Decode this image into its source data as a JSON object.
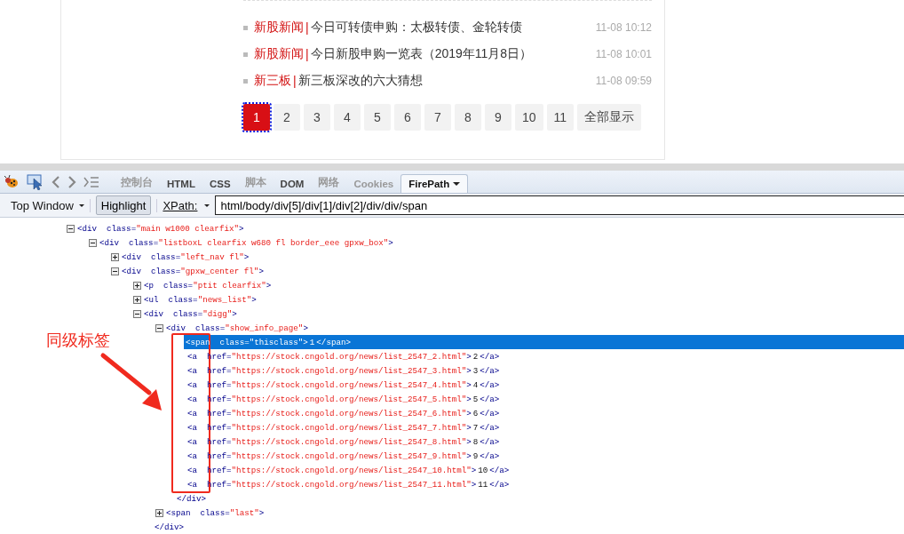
{
  "news": [
    {
      "category": "新股新闻",
      "separator": "|",
      "title": "今日可转债申购：太极转债、金轮转债",
      "time": "11-08 10:12"
    },
    {
      "category": "新股新闻",
      "separator": "|",
      "title": "今日新股申购一览表（2019年11月8日）",
      "time": "11-08 10:01"
    },
    {
      "category": "新三板",
      "separator": "|",
      "title": "新三板深改的六大猜想",
      "time": "11-08 09:59"
    }
  ],
  "pagination": [
    {
      "label": "1",
      "selected": true
    },
    {
      "label": "2",
      "selected": false
    },
    {
      "label": "3",
      "selected": false
    },
    {
      "label": "4",
      "selected": false
    },
    {
      "label": "5",
      "selected": false
    },
    {
      "label": "6",
      "selected": false
    },
    {
      "label": "7",
      "selected": false
    },
    {
      "label": "8",
      "selected": false
    },
    {
      "label": "9",
      "selected": false
    },
    {
      "label": "10",
      "selected": false
    },
    {
      "label": "11",
      "selected": false
    },
    {
      "label": "全部显示",
      "selected": false
    }
  ],
  "devtools": {
    "tabs": [
      {
        "label": "控制台",
        "selected": false,
        "disabled": true
      },
      {
        "label": "HTML",
        "selected": false,
        "disabled": false
      },
      {
        "label": "CSS",
        "selected": false,
        "disabled": false
      },
      {
        "label": "脚本",
        "selected": false,
        "disabled": true
      },
      {
        "label": "DOM",
        "selected": false,
        "disabled": false
      },
      {
        "label": "网络",
        "selected": false,
        "disabled": true
      },
      {
        "label": "Cookies",
        "selected": false,
        "disabled": true
      },
      {
        "label": "FirePath",
        "selected": true,
        "disabled": false,
        "dropdown": true
      }
    ],
    "window_select": "Top Window",
    "highlight": {
      "label": "Highlight",
      "on": true
    },
    "xpath_label": "XPath:",
    "xpath_value": "html/body/div[5]/div[1]/div[2]/div/div/span",
    "tree": [
      {
        "open": "<div",
        "attr": "class=",
        "value": "\"main w1000 clearfix\"",
        "end": ">",
        "expanded": true,
        "selected": false,
        "children": [
          {
            "open": "<div",
            "attr": "class=",
            "value": "\"listboxL clearfix w680 fl border_eee gpxw_box\"",
            "end": ">",
            "expanded": true,
            "selected": false,
            "children": [
              {
                "open": "<div",
                "attr": "class=",
                "value": "\"left_nav fl\"",
                "end": ">",
                "expanded": false,
                "selected": false
              },
              {
                "open": "<div",
                "attr": "class=",
                "value": "\"gpxw_center fl\"",
                "end": ">",
                "expanded": true,
                "selected": false,
                "children": [
                  {
                    "open": "<p",
                    "attr": "class=",
                    "value": "\"ptit clearfix\"",
                    "end": ">",
                    "expanded": false,
                    "selected": false
                  },
                  {
                    "open": "<ul",
                    "attr": "class=",
                    "value": "\"news_list\"",
                    "end": ">",
                    "expanded": false,
                    "selected": false
                  },
                  {
                    "open": "<div",
                    "attr": "class=",
                    "value": "\"digg\"",
                    "end": ">",
                    "expanded": true,
                    "selected": false,
                    "children": [
                      {
                        "open": "<div",
                        "attr": "class=",
                        "value": "\"show_info_page\"",
                        "end": ">",
                        "expanded": true,
                        "selected": false,
                        "children": [
                          {
                            "open": "<span",
                            "attr": "class=",
                            "value": "\"thisclass\"",
                            "end": ">",
                            "inner": "1",
                            "close": "</span>",
                            "selected": true
                          },
                          {
                            "open": "<a",
                            "attr": "href=",
                            "value": "\"https://stock.cngold.org/news/list_2547_2.html\"",
                            "end": ">",
                            "inner": "2",
                            "close": "</a>",
                            "selected": false
                          },
                          {
                            "open": "<a",
                            "attr": "href=",
                            "value": "\"https://stock.cngold.org/news/list_2547_3.html\"",
                            "end": ">",
                            "inner": "3",
                            "close": "</a>",
                            "selected": false
                          },
                          {
                            "open": "<a",
                            "attr": "href=",
                            "value": "\"https://stock.cngold.org/news/list_2547_4.html\"",
                            "end": ">",
                            "inner": "4",
                            "close": "</a>",
                            "selected": false
                          },
                          {
                            "open": "<a",
                            "attr": "href=",
                            "value": "\"https://stock.cngold.org/news/list_2547_5.html\"",
                            "end": ">",
                            "inner": "5",
                            "close": "</a>",
                            "selected": false
                          },
                          {
                            "open": "<a",
                            "attr": "href=",
                            "value": "\"https://stock.cngold.org/news/list_2547_6.html\"",
                            "end": ">",
                            "inner": "6",
                            "close": "</a>",
                            "selected": false
                          },
                          {
                            "open": "<a",
                            "attr": "href=",
                            "value": "\"https://stock.cngold.org/news/list_2547_7.html\"",
                            "end": ">",
                            "inner": "7",
                            "close": "</a>",
                            "selected": false
                          },
                          {
                            "open": "<a",
                            "attr": "href=",
                            "value": "\"https://stock.cngold.org/news/list_2547_8.html\"",
                            "end": ">",
                            "inner": "8",
                            "close": "</a>",
                            "selected": false
                          },
                          {
                            "open": "<a",
                            "attr": "href=",
                            "value": "\"https://stock.cngold.org/news/list_2547_9.html\"",
                            "end": ">",
                            "inner": "9",
                            "close": "</a>",
                            "selected": false
                          },
                          {
                            "open": "<a",
                            "attr": "href=",
                            "value": "\"https://stock.cngold.org/news/list_2547_10.html\"",
                            "end": ">",
                            "inner": "10",
                            "close": "</a>",
                            "selected": false
                          },
                          {
                            "open": "<a",
                            "attr": "href=",
                            "value": "\"https://stock.cngold.org/news/list_2547_11.html\"",
                            "end": ">",
                            "inner": "11",
                            "close": "</a>",
                            "selected": false
                          },
                          {
                            "kind": "close",
                            "text": "</div>"
                          }
                        ]
                      },
                      {
                        "open": "<span",
                        "attr": "class=",
                        "value": "\"last\"",
                        "end": ">",
                        "expanded": false,
                        "selected": false
                      },
                      {
                        "kind": "close",
                        "text": "</div>"
                      }
                    ]
                  }
                ]
              }
            ]
          }
        ]
      }
    ]
  },
  "annotation": {
    "label": "同级标签"
  }
}
